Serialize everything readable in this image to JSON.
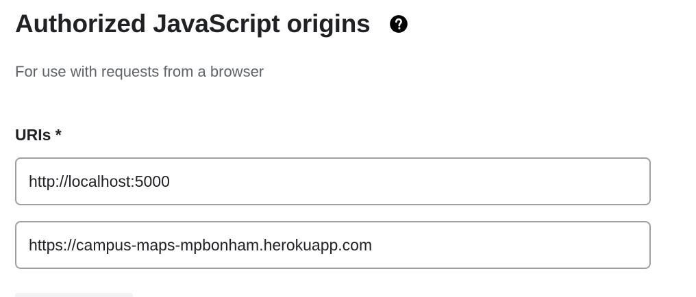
{
  "section": {
    "title": "Authorized JavaScript origins",
    "help_icon": "help-circle-icon",
    "subtitle": "For use with requests from a browser",
    "uris_label": "URIs *",
    "uris": [
      {
        "value": "http://localhost:5000"
      },
      {
        "value": "https://campus-maps-mpbonham.herokuapp.com"
      }
    ]
  },
  "colors": {
    "text": "#202124",
    "secondary_text": "#5f6368",
    "field_border": "#9aa0a6"
  }
}
